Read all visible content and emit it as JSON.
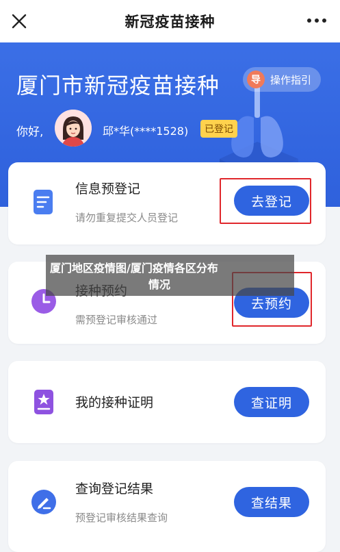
{
  "navbar": {
    "title": "新冠疫苗接种",
    "close_icon": "close-icon",
    "more_icon": "more-dots-icon"
  },
  "hero": {
    "title": "厦门市新冠疫苗接种",
    "guide_button": {
      "icon_text": "导",
      "label": "操作指引"
    },
    "greeting": "你好,",
    "user_name": "邱*华(****1528)",
    "status_badge": "已登记",
    "accent_color": "#3366e0"
  },
  "cards": [
    {
      "title": "信息预登记",
      "subtitle": "请勿重复提交人员登记",
      "button": "去登记",
      "icon": "form-icon",
      "icon_color": "#4a7df0"
    },
    {
      "title": "接种预约",
      "subtitle": "需预登记审核通过",
      "button": "去预约",
      "icon": "clock-icon",
      "icon_color": "#9a5ce6"
    },
    {
      "title": "我的接种证明",
      "subtitle": "",
      "button": "查证明",
      "icon": "certificate-icon",
      "icon_color": "#8e52e0"
    },
    {
      "title": "查询登记结果",
      "subtitle": "预登记审核结果查询",
      "button": "查结果",
      "icon": "edit-icon",
      "icon_color": "#3f6fe8"
    }
  ],
  "overlay": {
    "line1": "厦门地区疫情图/厦门疫情各区分布",
    "line2": "情况"
  }
}
